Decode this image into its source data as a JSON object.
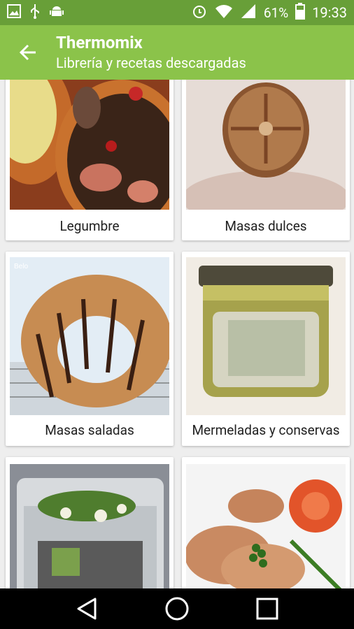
{
  "status_bar": {
    "battery_percent": "61%",
    "time": "19:33",
    "icons": [
      "image-icon",
      "usb-icon",
      "android-icon",
      "alarm-icon",
      "wifi-icon",
      "signal-icon",
      "battery-icon"
    ]
  },
  "app_bar": {
    "title": "Thermomix",
    "subtitle": "Librería y recetas descargadas"
  },
  "categories": [
    {
      "label": "Legumbre"
    },
    {
      "label": "Masas dulces"
    },
    {
      "label": "Masas saladas"
    },
    {
      "label": "Mermeladas y conservas"
    },
    {
      "label": ""
    },
    {
      "label": ""
    }
  ],
  "colors": {
    "status_bar": "#689f38",
    "app_bar": "#8bc34a",
    "background": "#eeeeee"
  }
}
